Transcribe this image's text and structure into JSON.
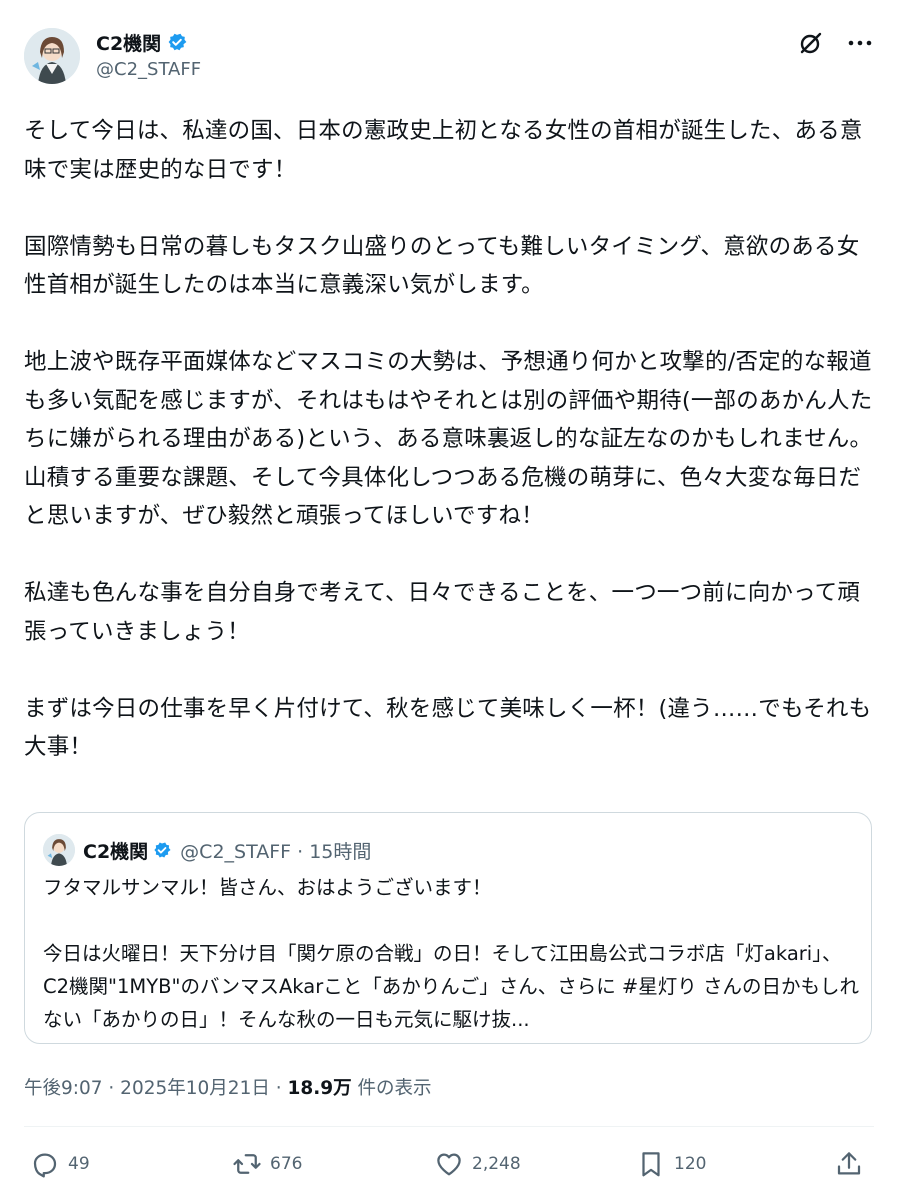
{
  "author": {
    "display_name": "C2機関",
    "handle": "@C2_STAFF"
  },
  "tweet": {
    "text": "そして今日は、私達の国、日本の憲政史上初となる女性の首相が誕生した、ある意味で実は歴史的な日です！\n\n国際情勢も日常の暮しもタスク山盛りのとっても難しいタイミング、意欲のある女性首相が誕生したのは本当に意義深い気がします。\n\n地上波や既存平面媒体などマスコミの大勢は、予想通り何かと攻撃的/否定的な報道も多い気配を感じますが、それはもはやそれとは別の評価や期待(一部のあかん人たちに嫌がられる理由がある)という、ある意味裏返し的な証左なのかもしれません。\n山積する重要な課題、そして今具体化しつつある危機の萌芽に、色々大変な毎日だと思いますが、ぜひ毅然と頑張ってほしいですね！\n\n私達も色んな事を自分自身で考えて、日々できることを、一つ一つ前に向かって頑張っていきましょう！\n\nまずは今日の仕事を早く片付けて、秋を感じて美味しく一杯！(違う……でもそれも大事！"
  },
  "quote": {
    "display_name": "C2機関",
    "handle_time": "@C2_STAFF · 15時間",
    "text": "フタマルサンマル！皆さん、おはようございます！\n\n今日は火曜日！天下分け目「関ケ原の合戦」の日！そして江田島公式コラボ店「灯akari」、C2機関\"1MYB\"のバンマスAkarこと「あかりんご」さん、さらに #星灯り さんの日かもしれない「あかりの日」！そんな秋の一日も元気に駆け抜..."
  },
  "meta": {
    "time": "午後9:07 · 2025年10月21日 · ",
    "views": "18.9万",
    "views_label": " 件の表示"
  },
  "actions": {
    "reply_count": "49",
    "retweet_count": "676",
    "like_count": "2,248",
    "bookmark_count": "120"
  },
  "icons": {
    "verified": "verified-badge-icon",
    "grok": "grok-icon",
    "more": "more-icon",
    "reply": "reply-icon",
    "retweet": "retweet-icon",
    "like": "heart-icon",
    "bookmark": "bookmark-icon",
    "share": "share-icon"
  },
  "colors": {
    "verified": "#1d9bf0",
    "text": "#0f1419",
    "muted": "#536471",
    "border": "#cfd9de"
  }
}
